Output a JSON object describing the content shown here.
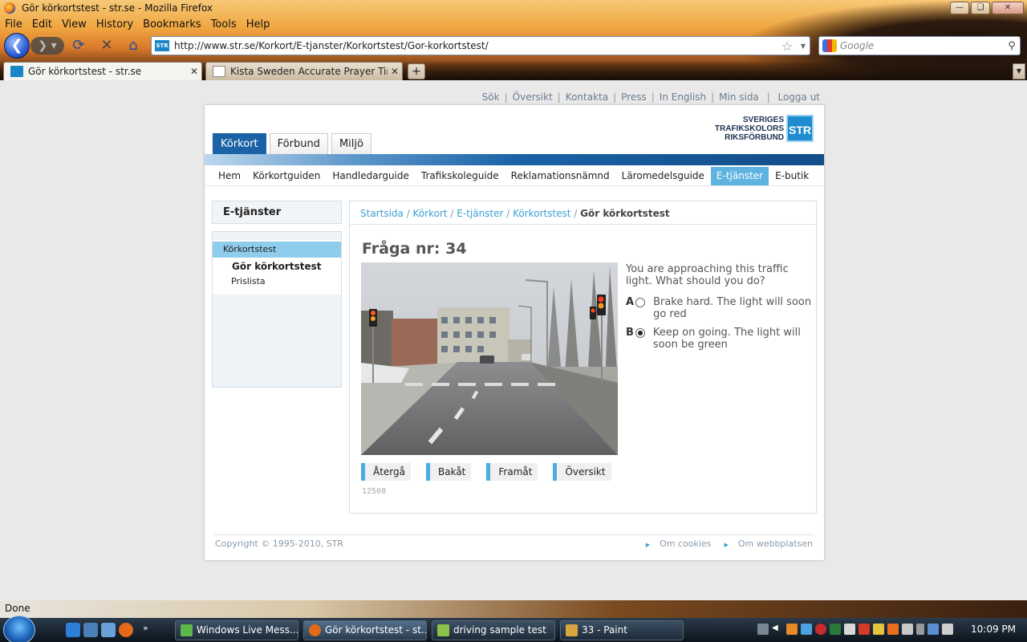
{
  "window": {
    "title": "Gör körkortstest - str.se - Mozilla Firefox"
  },
  "menu": [
    "File",
    "Edit",
    "View",
    "History",
    "Bookmarks",
    "Tools",
    "Help"
  ],
  "navbar": {
    "url": "http://www.str.se/Korkort/E-tjanster/Korkortstest/Gor-korkortstest/",
    "search_placeholder": "Google",
    "site_badge": "STR"
  },
  "tabs": [
    {
      "label": "Gör körkortstest - str.se",
      "active": true
    },
    {
      "label": "Kista Sweden Accurate Prayer Time...",
      "active": false
    }
  ],
  "page": {
    "utility_links": [
      "Sök",
      "Översikt",
      "Kontakta",
      "Press",
      "In English",
      "Min sida",
      "Logga ut"
    ],
    "logo": {
      "line1": "SVERIGES",
      "line2": "TRAFIKSKOLORS",
      "line3": "RIKSFÖRBUND",
      "mark": "STR"
    },
    "main_tabs": [
      "Körkort",
      "Förbund",
      "Miljö"
    ],
    "sub_nav": [
      "Hem",
      "Körkortguiden",
      "Handledarguide",
      "Trafikskoleguide",
      "Reklamationsnämnd",
      "Läromedelsguide",
      "E-tjänster",
      "E-butik"
    ],
    "sidebar": {
      "heading": "E-tjänster",
      "items": [
        {
          "label": "Körkortstest",
          "selected": true
        },
        {
          "label": "Gör körkortstest",
          "current": true
        },
        {
          "label": "Prislista"
        }
      ]
    },
    "breadcrumb": {
      "links": [
        "Startsida",
        "Körkort",
        "E-tjänster",
        "Körkortstest"
      ],
      "current": "Gör körkortstest"
    },
    "question": {
      "number_label": "Fråga nr: 34",
      "text": "You are approaching this traffic light. What should you do?",
      "options": [
        {
          "letter": "A",
          "text": "Brake hard. The light will soon go red",
          "selected": false
        },
        {
          "letter": "B",
          "text": "Keep on going. The light will soon be green",
          "selected": true
        }
      ]
    },
    "actions": [
      "Återgå",
      "Bakåt",
      "Framåt",
      "Översikt"
    ],
    "code": "12508",
    "footer": {
      "copyright": "Copyright © 1995-2010, STR",
      "links": [
        "Om cookies",
        "Om webbplatsen"
      ]
    }
  },
  "statusbar": {
    "text": "Done"
  },
  "taskbar": {
    "buttons": [
      {
        "label": "Windows Live Mess...",
        "active": false
      },
      {
        "label": "Gör körkortstest - st...",
        "active": true
      },
      {
        "label": "driving sample test",
        "active": false
      },
      {
        "label": "33 - Paint",
        "active": false
      }
    ],
    "clock": "10:09 PM"
  }
}
